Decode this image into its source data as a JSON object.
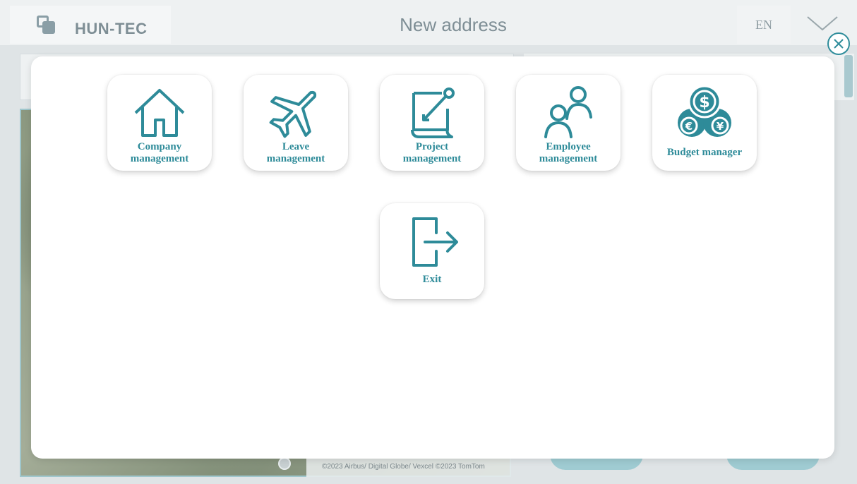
{
  "header": {
    "brand": "HUN-TEC",
    "title": "New address",
    "language": "EN"
  },
  "map": {
    "credit": "©2023 Airbus/ Digital Globe/ Vexcel ©2023 TomTom"
  },
  "menu": {
    "tiles": [
      {
        "label_line1": "Company",
        "label_line2": "management",
        "icon": "house-icon"
      },
      {
        "label_line1": "Leave",
        "label_line2": "management",
        "icon": "airplane-icon"
      },
      {
        "label_line1": "Project",
        "label_line2": "management",
        "icon": "document-pencil-icon"
      },
      {
        "label_line1": "Employee",
        "label_line2": "management",
        "icon": "people-icon"
      },
      {
        "label": "Budget manager",
        "icon": "currency-coins-icon"
      },
      {
        "label": "Exit",
        "icon": "exit-door-icon"
      }
    ]
  },
  "colors": {
    "accent": "#2e8b99",
    "modal_bg": "#ffffff",
    "backdrop": "#dfe4e6"
  }
}
